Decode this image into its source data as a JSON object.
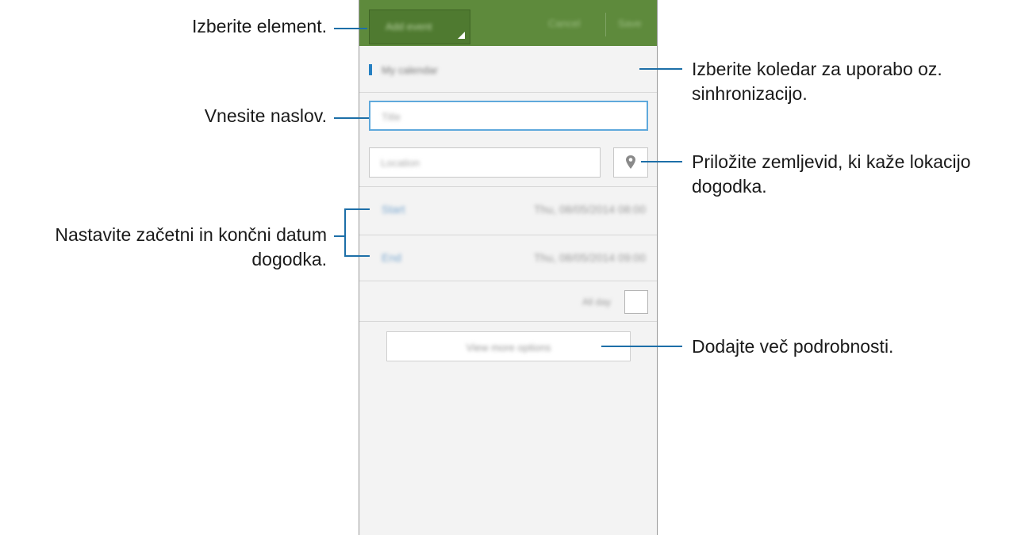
{
  "callouts": {
    "select_item": "Izberite element.",
    "enter_title": "Vnesite naslov.",
    "set_dates_line1": "Nastavite začetni in končni datum",
    "set_dates_line2": "dogodka.",
    "select_calendar_line1": "Izberite koledar za uporabo oz.",
    "select_calendar_line2": "sinhronizacijo.",
    "attach_map_line1": "Priložite zemljevid, ki kaže lokacijo",
    "attach_map_line2": "dogodka.",
    "add_details": "Dodajte več podrobnosti."
  },
  "app": {
    "item_type": "Add event",
    "cancel_label": "Cancel",
    "save_label": "Save",
    "calendar_name": "My calendar",
    "title_placeholder": "Title",
    "location_placeholder": "Location",
    "start_label": "Start",
    "start_value": "Thu, 08/05/2014  08:00",
    "end_label": "End",
    "end_value": "Thu, 08/05/2014  09:00",
    "all_day_label": "All day",
    "more_options_label": "View more options"
  },
  "icons": {
    "location": "map-pin-icon"
  },
  "colors": {
    "header_green": "#5e8a3c",
    "accent_blue": "#2680c2",
    "callout_line": "#1d6fa8"
  }
}
